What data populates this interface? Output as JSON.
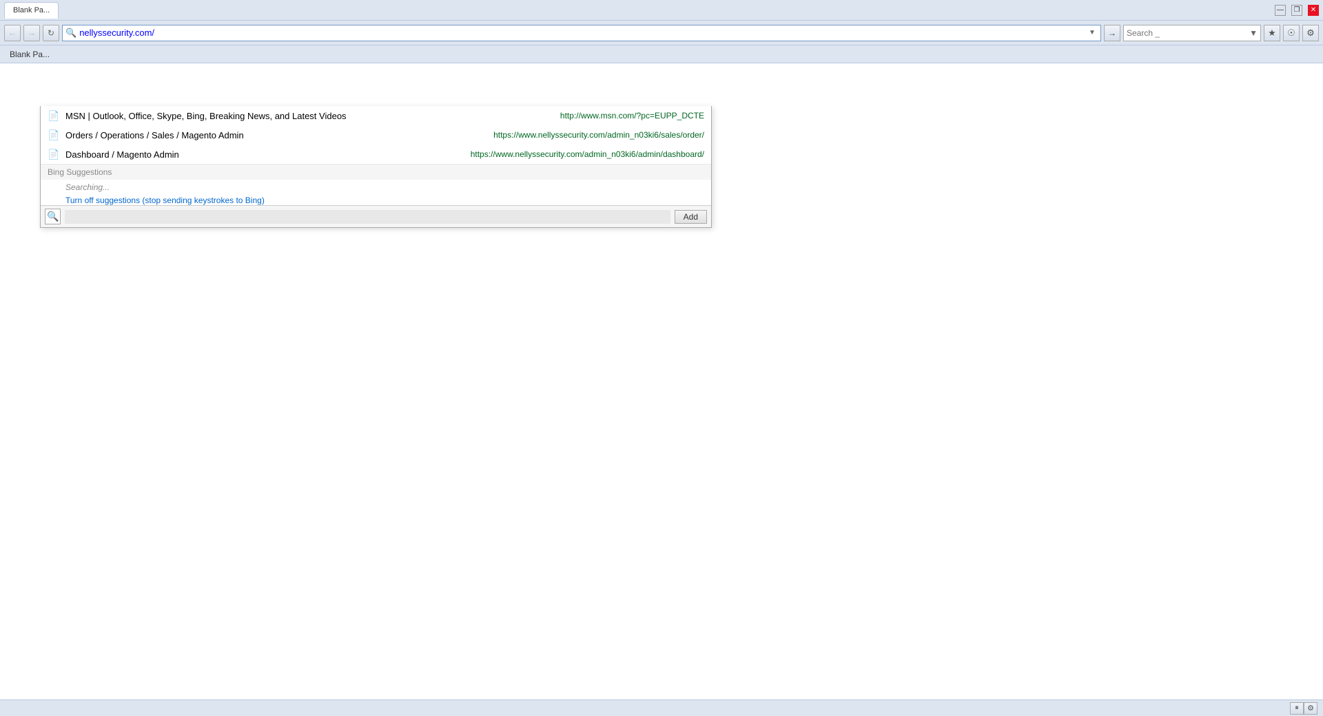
{
  "browser": {
    "tab": {
      "label": "Blank Pa..."
    },
    "window_controls": {
      "minimize": "—",
      "restore": "❐",
      "close": "✕"
    },
    "nav": {
      "back_disabled": true,
      "forward_disabled": true,
      "address": "nellyssecurity.com/",
      "go_arrow": "→",
      "search_placeholder": "Search _"
    },
    "favorites": {
      "item": "Blank Pa..."
    }
  },
  "autocomplete": {
    "history_items": [
      {
        "title": "MSN | Outlook, Office, Skype, Bing, Breaking News, and Latest Videos",
        "url": "http://www.msn.com/?pc=EUPP_DCTE",
        "icon": "🌐"
      },
      {
        "title": "Orders / Operations / Sales / Magento Admin",
        "url": "https://www.nellyssecurity.com/admin_n03ki6/sales/order/",
        "icon": "🌐"
      },
      {
        "title": "Dashboard / Magento Admin",
        "url": "https://www.nellyssecurity.com/admin_n03ki6/admin/dashboard/",
        "icon": "🌐"
      }
    ],
    "section_header": "Bing Suggestions",
    "searching_text": "Searching...",
    "turn_off_text": "Turn off suggestions (stop sending keystrokes to Bing)",
    "search_placeholder": "",
    "add_button": "Add"
  },
  "status_bar": {
    "pause_btn": "⏸",
    "gear_btn": "⚙"
  }
}
